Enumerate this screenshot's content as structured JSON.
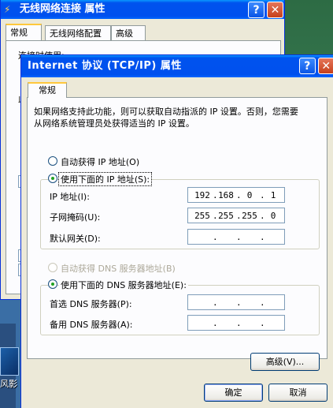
{
  "back_window": {
    "title": "无线网络连接 属性",
    "tabs": [
      "常规",
      "无线网络配置",
      "高级"
    ],
    "partial_text": "连接时使用:",
    "partial_char": "此"
  },
  "dialog": {
    "title": "Internet 协议 (TCP/IP) 属性",
    "help_glyph": "?",
    "close_glyph": "✕",
    "tab": "常规",
    "description": "如果网络支持此功能，则可以获取自动指派的 IP 设置。否则，您需要从网络系统管理员处获得适当的 IP 设置。",
    "auto_ip_label": "自动获得 IP 地址(O)",
    "manual_ip_label": "使用下面的 IP 地址(S):",
    "ip_label": "IP 地址(I):",
    "mask_label": "子网掩码(U):",
    "gateway_label": "默认网关(D):",
    "ip_value": [
      "192",
      "168",
      "0",
      "1"
    ],
    "mask_value": [
      "255",
      "255",
      "255",
      "0"
    ],
    "gateway_value": [
      "",
      "",
      "",
      ""
    ],
    "auto_dns_label": "自动获得 DNS 服务器地址(B)",
    "manual_dns_label": "使用下面的 DNS 服务器地址(E):",
    "dns1_label": "首选 DNS 服务器(P):",
    "dns2_label": "备用 DNS 服务器(A):",
    "dns1_value": [
      "",
      "",
      "",
      ""
    ],
    "dns2_value": [
      "",
      "",
      "",
      ""
    ],
    "advanced_button": "高级(V)...",
    "ok_button": "确定",
    "cancel_button": "取消",
    "selected_ip_mode": "manual",
    "selected_dns_mode": "manual"
  },
  "desktop": {
    "icon_label": "风影"
  },
  "colors": {
    "titlebar": "#0053ee",
    "dialog_bg": "#ece9d8",
    "radio_dot": "#21a121",
    "desktop_bg": "#3a6ea5"
  }
}
